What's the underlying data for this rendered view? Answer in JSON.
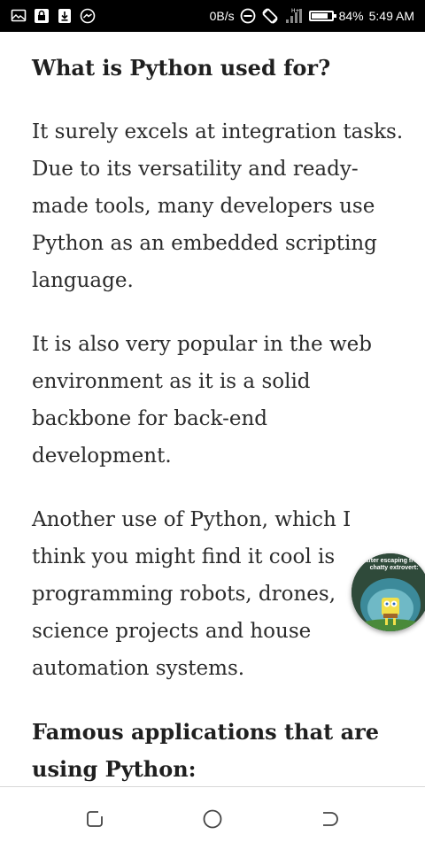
{
  "status_bar": {
    "network_speed": "0B/s",
    "battery_percent": "84%",
    "battery_level": 0.84,
    "time": "5:49 AM",
    "left_icons": [
      "screen-cast-icon",
      "lock-icon",
      "download-icon",
      "messenger-icon"
    ],
    "right_icons": [
      "do-not-disturb-icon",
      "rotate-icon",
      "signal-icon",
      "battery-icon"
    ]
  },
  "article": {
    "heading_1": "What is Python used for?",
    "paragraph_1": "It surely excels at integration tasks. Due to its versatility and ready-made tools, many developers use Python as an embedded scripting language.",
    "paragraph_2": "It is also very popular in the web environment as it is a solid backbone for back-end development.",
    "paragraph_3": "Another use of Python, which I think you might find it cool is programming robots, drones, science projects and house automation systems.",
    "heading_2": "Famous applications that are using Python:"
  },
  "chat_head": {
    "caption": "after escaping from chatty extrovert:"
  },
  "nav_bar": {
    "buttons": [
      "recent-apps",
      "home",
      "back"
    ]
  },
  "colors": {
    "status_bar_bg": "#000000",
    "text": "#2b2b2b",
    "background": "#ffffff",
    "nav_icon": "#444444"
  }
}
